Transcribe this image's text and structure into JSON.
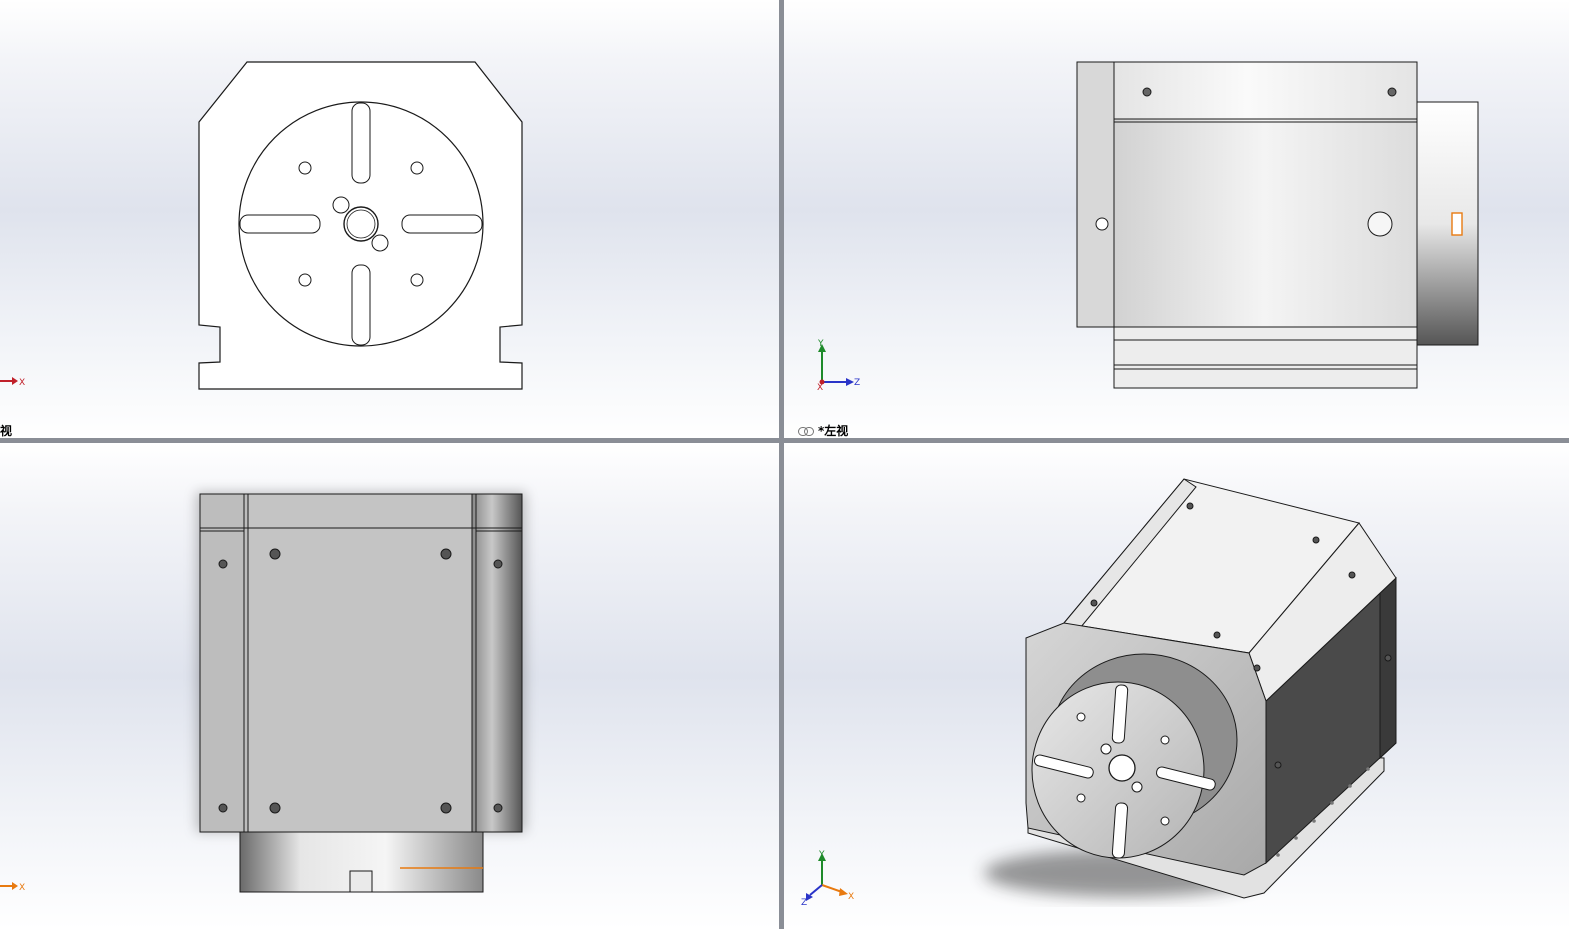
{
  "viewports": [
    {
      "id": "front",
      "label": "视",
      "prefix_icon": false
    },
    {
      "id": "left",
      "label": "*左视",
      "prefix_icon": true,
      "prefix_icon_name": "link-icon"
    },
    {
      "id": "top",
      "label": ""
    },
    {
      "id": "iso",
      "label": ""
    }
  ],
  "triads": {
    "front": {
      "x": "X"
    },
    "left": {
      "y": "Y",
      "z": "Z",
      "x": "X"
    },
    "top": {
      "x": "X"
    },
    "iso": {
      "y": "Y",
      "z": "Z",
      "x": "X"
    }
  },
  "colors": {
    "edge": "#1a1a1a",
    "axis_x": "#c0202a",
    "axis_y": "#1e8a2a",
    "axis_z": "#2a34c8",
    "accent_orange": "#e87a10",
    "splitter": "#8a8e96"
  }
}
